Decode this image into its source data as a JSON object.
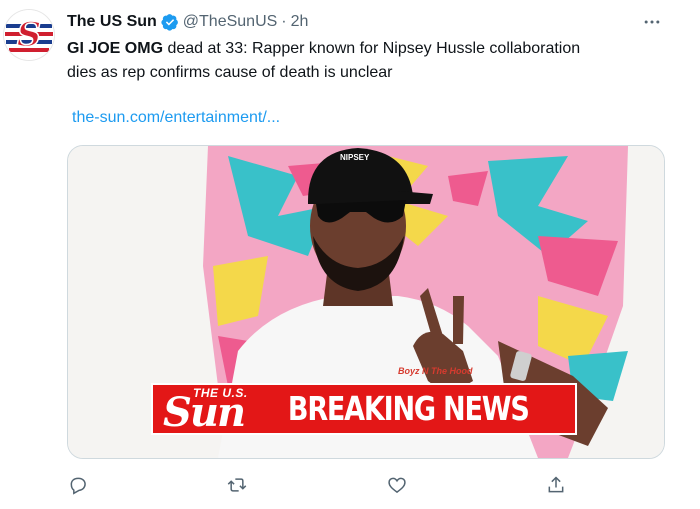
{
  "account": {
    "name": "The US Sun",
    "handle": "@TheSunUS",
    "separator": "·",
    "time": "2h",
    "avatar_letter": "S"
  },
  "tweet": {
    "bold_text": "GI JOE OMG",
    "text_line1": " dead at 33: Rapper known for Nipsey Hussle collaboration",
    "text_line2": "dies as rep confirms cause of death is unclear",
    "link": "the-sun.com/entertainment/..."
  },
  "media": {
    "banner_small": "THE U.S.",
    "banner_logo": "Sun",
    "banner_text": "BREAKING NEWS",
    "shirt_text": "Boyz N The Hood"
  },
  "icons": {
    "more": "more-horizontal-icon",
    "reply": "reply-icon",
    "retweet": "retweet-icon",
    "like": "like-icon",
    "share": "share-icon",
    "verified": "verified-badge-icon"
  },
  "colors": {
    "accent": "#1d9bf0",
    "text_secondary": "#536471",
    "brand_red": "#e31717"
  }
}
